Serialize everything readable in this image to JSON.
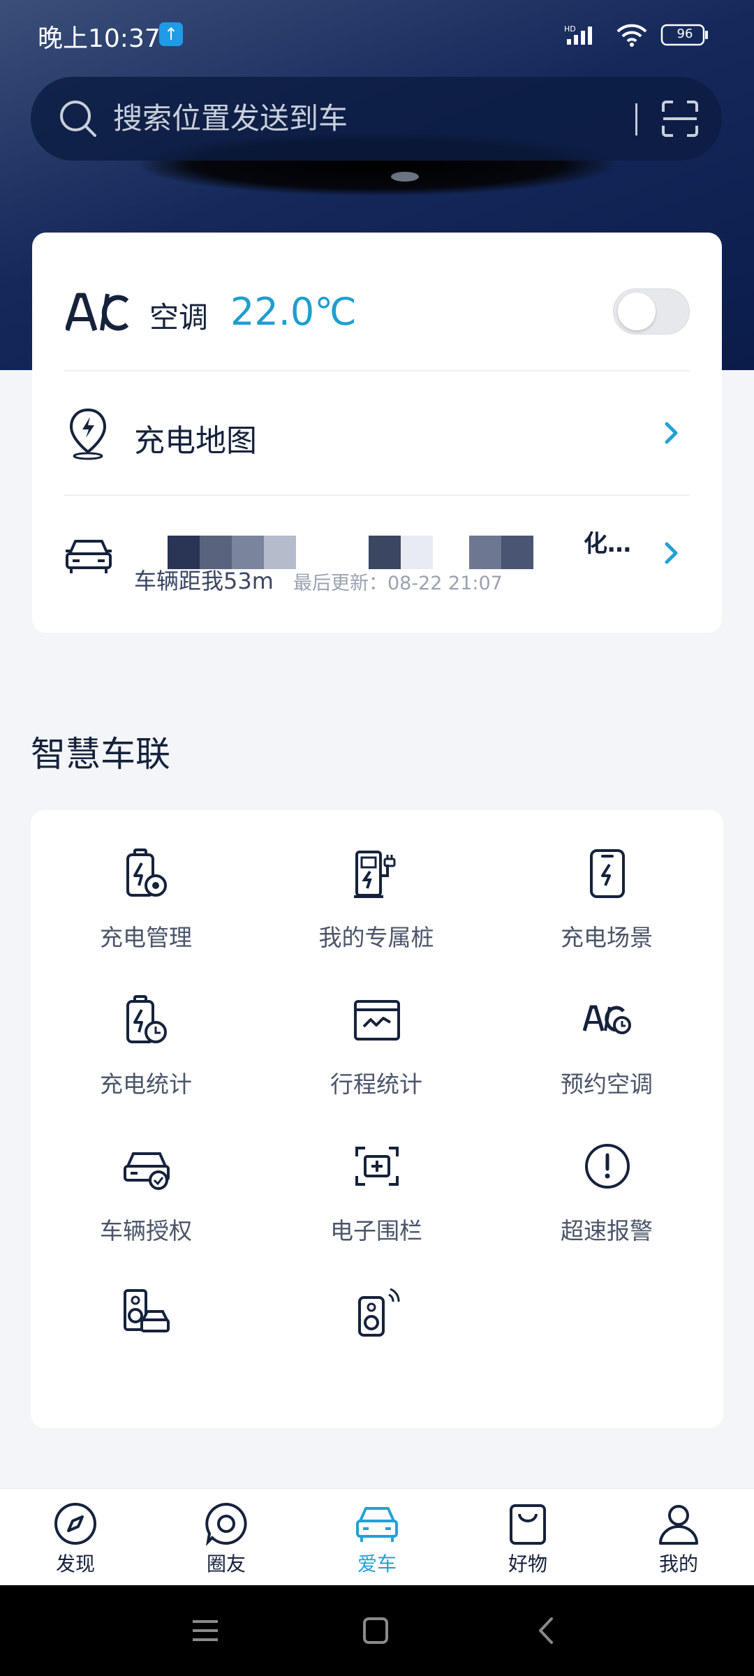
{
  "status_bar": {
    "time": "晚上10:37",
    "upload_badge": "↑",
    "battery": "96",
    "network": "HD"
  },
  "search": {
    "placeholder": "搜索位置发送到车"
  },
  "ac": {
    "logo": "A/C",
    "label": "空调",
    "temperature": "22.0℃",
    "enabled": false
  },
  "charge_map": {
    "label": "充电地图"
  },
  "vehicle_location": {
    "address_visible_tail": "化…",
    "distance": "车辆距我53m",
    "updated": "最后更新：08-22 21:07"
  },
  "section": {
    "title": "智慧车联"
  },
  "functions": [
    {
      "label": "充电管理",
      "icon": "battery-gear-icon"
    },
    {
      "label": "我的专属桩",
      "icon": "charging-pile-icon"
    },
    {
      "label": "充电场景",
      "icon": "phone-bolt-icon"
    },
    {
      "label": "充电统计",
      "icon": "battery-clock-icon"
    },
    {
      "label": "行程统计",
      "icon": "chart-window-icon"
    },
    {
      "label": "预约空调",
      "icon": "ac-clock-icon"
    },
    {
      "label": "车辆授权",
      "icon": "car-check-icon"
    },
    {
      "label": "电子围栏",
      "icon": "fence-plus-icon"
    },
    {
      "label": "超速报警",
      "icon": "alert-circle-icon"
    },
    {
      "label": "",
      "icon": "speaker-car-icon"
    },
    {
      "label": "",
      "icon": "speaker-wave-icon"
    }
  ],
  "bottom_nav": [
    {
      "label": "发现",
      "icon": "compass-icon",
      "active": false
    },
    {
      "label": "圈友",
      "icon": "chat-bubble-icon",
      "active": false
    },
    {
      "label": "爱车",
      "icon": "car-icon",
      "active": true
    },
    {
      "label": "好物",
      "icon": "bag-icon",
      "active": false
    },
    {
      "label": "我的",
      "icon": "user-icon",
      "active": false
    }
  ],
  "colors": {
    "accent": "#1f9ecf",
    "primary_text": "#16223c",
    "hero_dark": "#0b1c4a"
  }
}
